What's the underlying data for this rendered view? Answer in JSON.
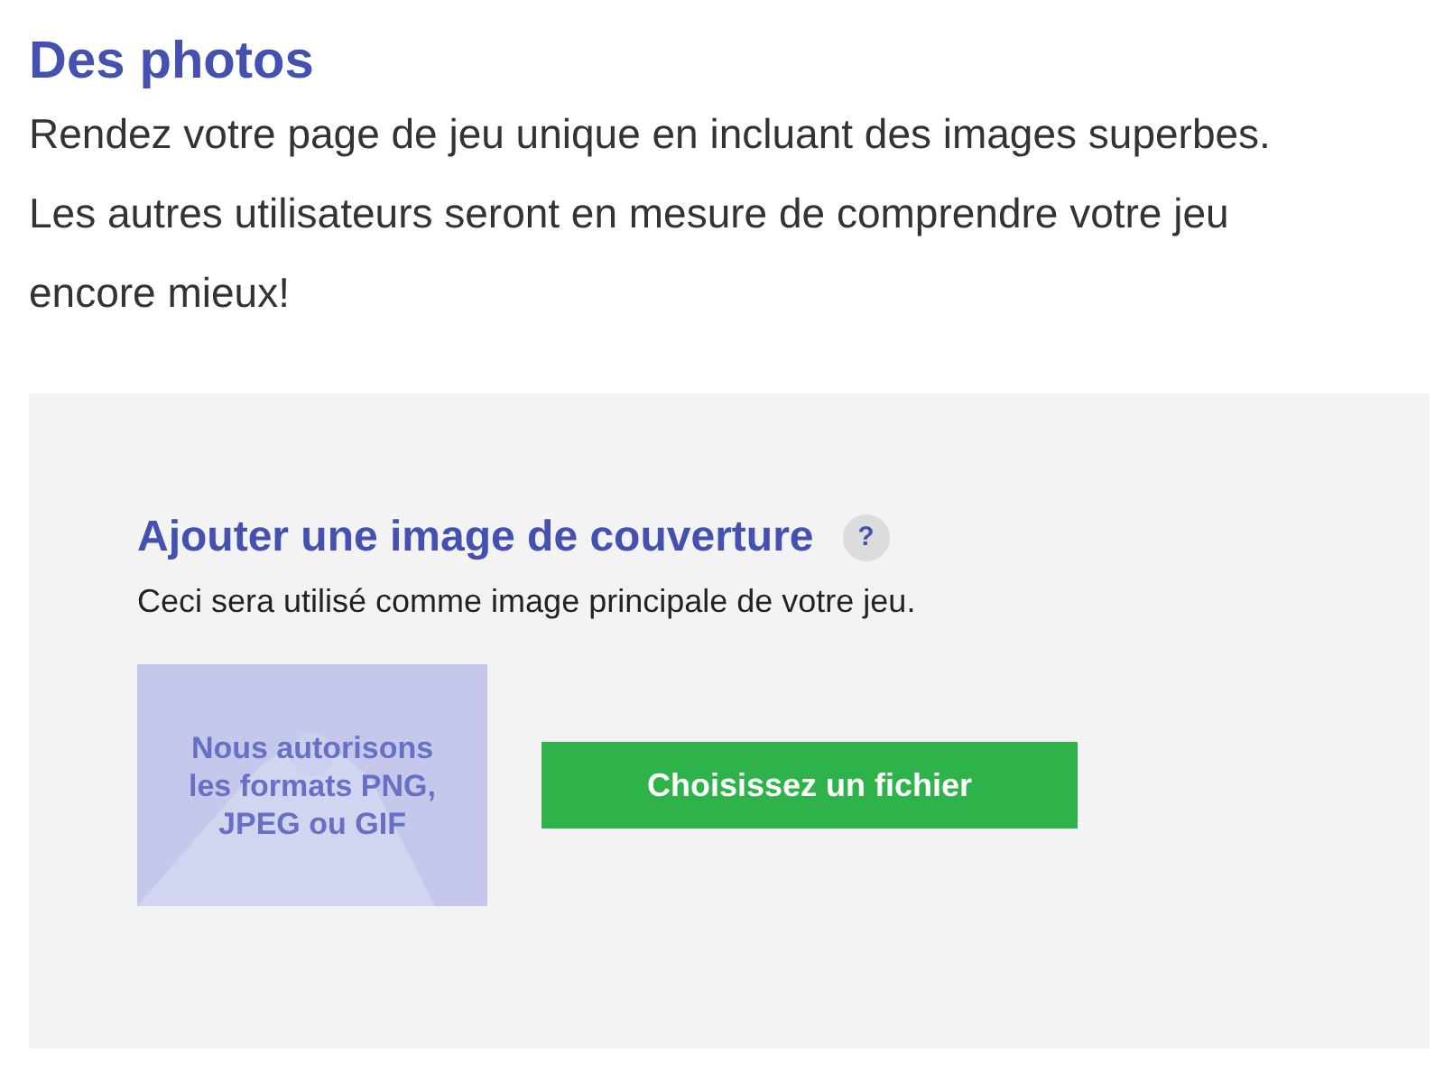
{
  "section": {
    "title": "Des photos",
    "description": "Rendez votre page de jeu unique en incluant des images superbes. Les autres utilisateurs seront en mesure de comprendre votre jeu encore mieux!"
  },
  "cover": {
    "title": "Ajouter une image de couverture",
    "help": "?",
    "description": "Ceci sera utilisé comme image principale de votre jeu.",
    "placeholder": "Nous autorisons les formats PNG, JPEG ou GIF",
    "button": "Choisissez un fichier"
  }
}
